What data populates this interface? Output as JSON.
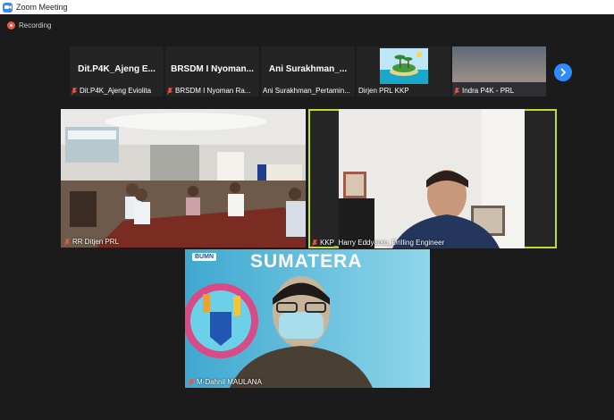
{
  "window": {
    "title": "Zoom Meeting"
  },
  "recording": {
    "label": "Recording"
  },
  "strip": {
    "participants": [
      {
        "display": "Dit.P4K_Ajeng  E...",
        "caption": "Dit.P4K_Ajeng Eviolita",
        "muted": true
      },
      {
        "display": "BRSDM I Nyoman...",
        "caption": "BRSDM I Nyoman Ra...",
        "muted": true
      },
      {
        "display": "Ani  Surakhman_...",
        "caption": "Ani Surakhman_Pertamin...",
        "muted": false
      },
      {
        "display": "",
        "caption": "Dirjen PRL KKP",
        "muted": false
      },
      {
        "display": "",
        "caption": "Indra P4K - PRL",
        "muted": true
      }
    ]
  },
  "gallery": {
    "tiles": [
      {
        "name": "RR Ditjen PRL",
        "muted": true
      },
      {
        "name": "KKP_Harry Eddyarso_Drilling Engineer",
        "muted": true,
        "active": true
      },
      {
        "name": "M-Dahnil MAULANA",
        "muted": true
      }
    ]
  },
  "background": {
    "banner_text": "SUMATERA",
    "logo_text": "BUMN"
  },
  "colors": {
    "accent": "#2d8cff",
    "active_border": "#b9dd3f",
    "muted_red": "#e8554a"
  }
}
